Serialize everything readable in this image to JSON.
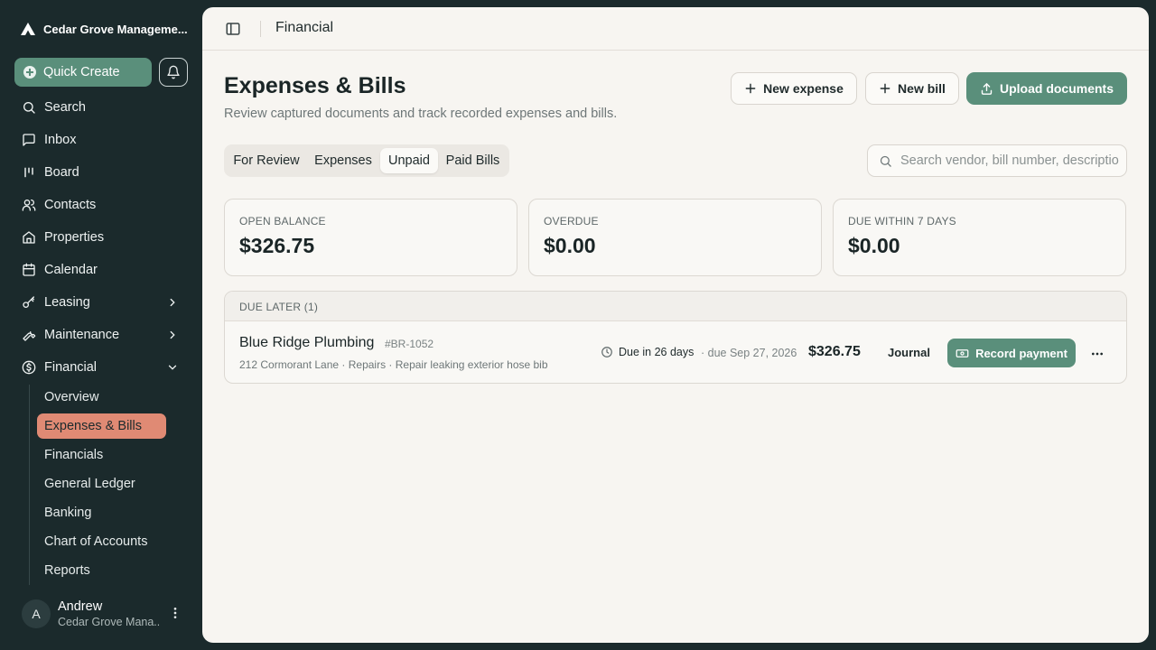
{
  "sidebar": {
    "brand": "Cedar Grove Manageme...",
    "quick_create": "Quick Create",
    "nav": [
      {
        "label": "Search",
        "icon": "search-icon"
      },
      {
        "label": "Inbox",
        "icon": "inbox-icon"
      },
      {
        "label": "Board",
        "icon": "board-icon"
      },
      {
        "label": "Contacts",
        "icon": "contacts-icon"
      },
      {
        "label": "Properties",
        "icon": "home-icon"
      },
      {
        "label": "Calendar",
        "icon": "calendar-icon"
      },
      {
        "label": "Leasing",
        "icon": "key-icon"
      },
      {
        "label": "Maintenance",
        "icon": "wrench-icon"
      },
      {
        "label": "Financial",
        "icon": "dollar-icon"
      }
    ],
    "financial_sub": [
      "Overview",
      "Expenses & Bills",
      "Financials",
      "General Ledger",
      "Banking",
      "Chart of Accounts",
      "Reports"
    ],
    "active_sub": "Expenses & Bills",
    "user": {
      "initial": "A",
      "name": "Andrew",
      "org": "Cedar Grove Mana..."
    }
  },
  "topbar": {
    "title": "Financial"
  },
  "page": {
    "title": "Expenses & Bills",
    "subtitle": "Review captured documents and track recorded expenses and bills."
  },
  "actions": {
    "new_expense": "New expense",
    "new_bill": "New bill",
    "upload": "Upload documents"
  },
  "tabs": [
    "For Review",
    "Expenses",
    "Unpaid",
    "Paid Bills"
  ],
  "active_tab": "Unpaid",
  "search": {
    "placeholder": "Search vendor, bill number, description..."
  },
  "cards": [
    {
      "label": "OPEN BALANCE",
      "value": "$326.75"
    },
    {
      "label": "OVERDUE",
      "value": "$0.00"
    },
    {
      "label": "DUE WITHIN 7 DAYS",
      "value": "$0.00"
    }
  ],
  "list": {
    "group_label": "DUE LATER (1)",
    "rows": [
      {
        "vendor": "Blue Ridge Plumbing",
        "bill_number": "#BR-1052",
        "meta": "212 Cormorant Lane · Repairs · Repair leaking exterior hose bib",
        "due": "Due in 26 days",
        "due_date": "· due Sep 27, 2026",
        "amount": "$326.75",
        "journal": "Journal",
        "action": "Record payment"
      }
    ]
  },
  "colors": {
    "sidebar_bg": "#1b2a2c",
    "accent": "#5a8f7b",
    "active_nav": "#e08a74",
    "panel_bg": "#f7f5f1"
  }
}
